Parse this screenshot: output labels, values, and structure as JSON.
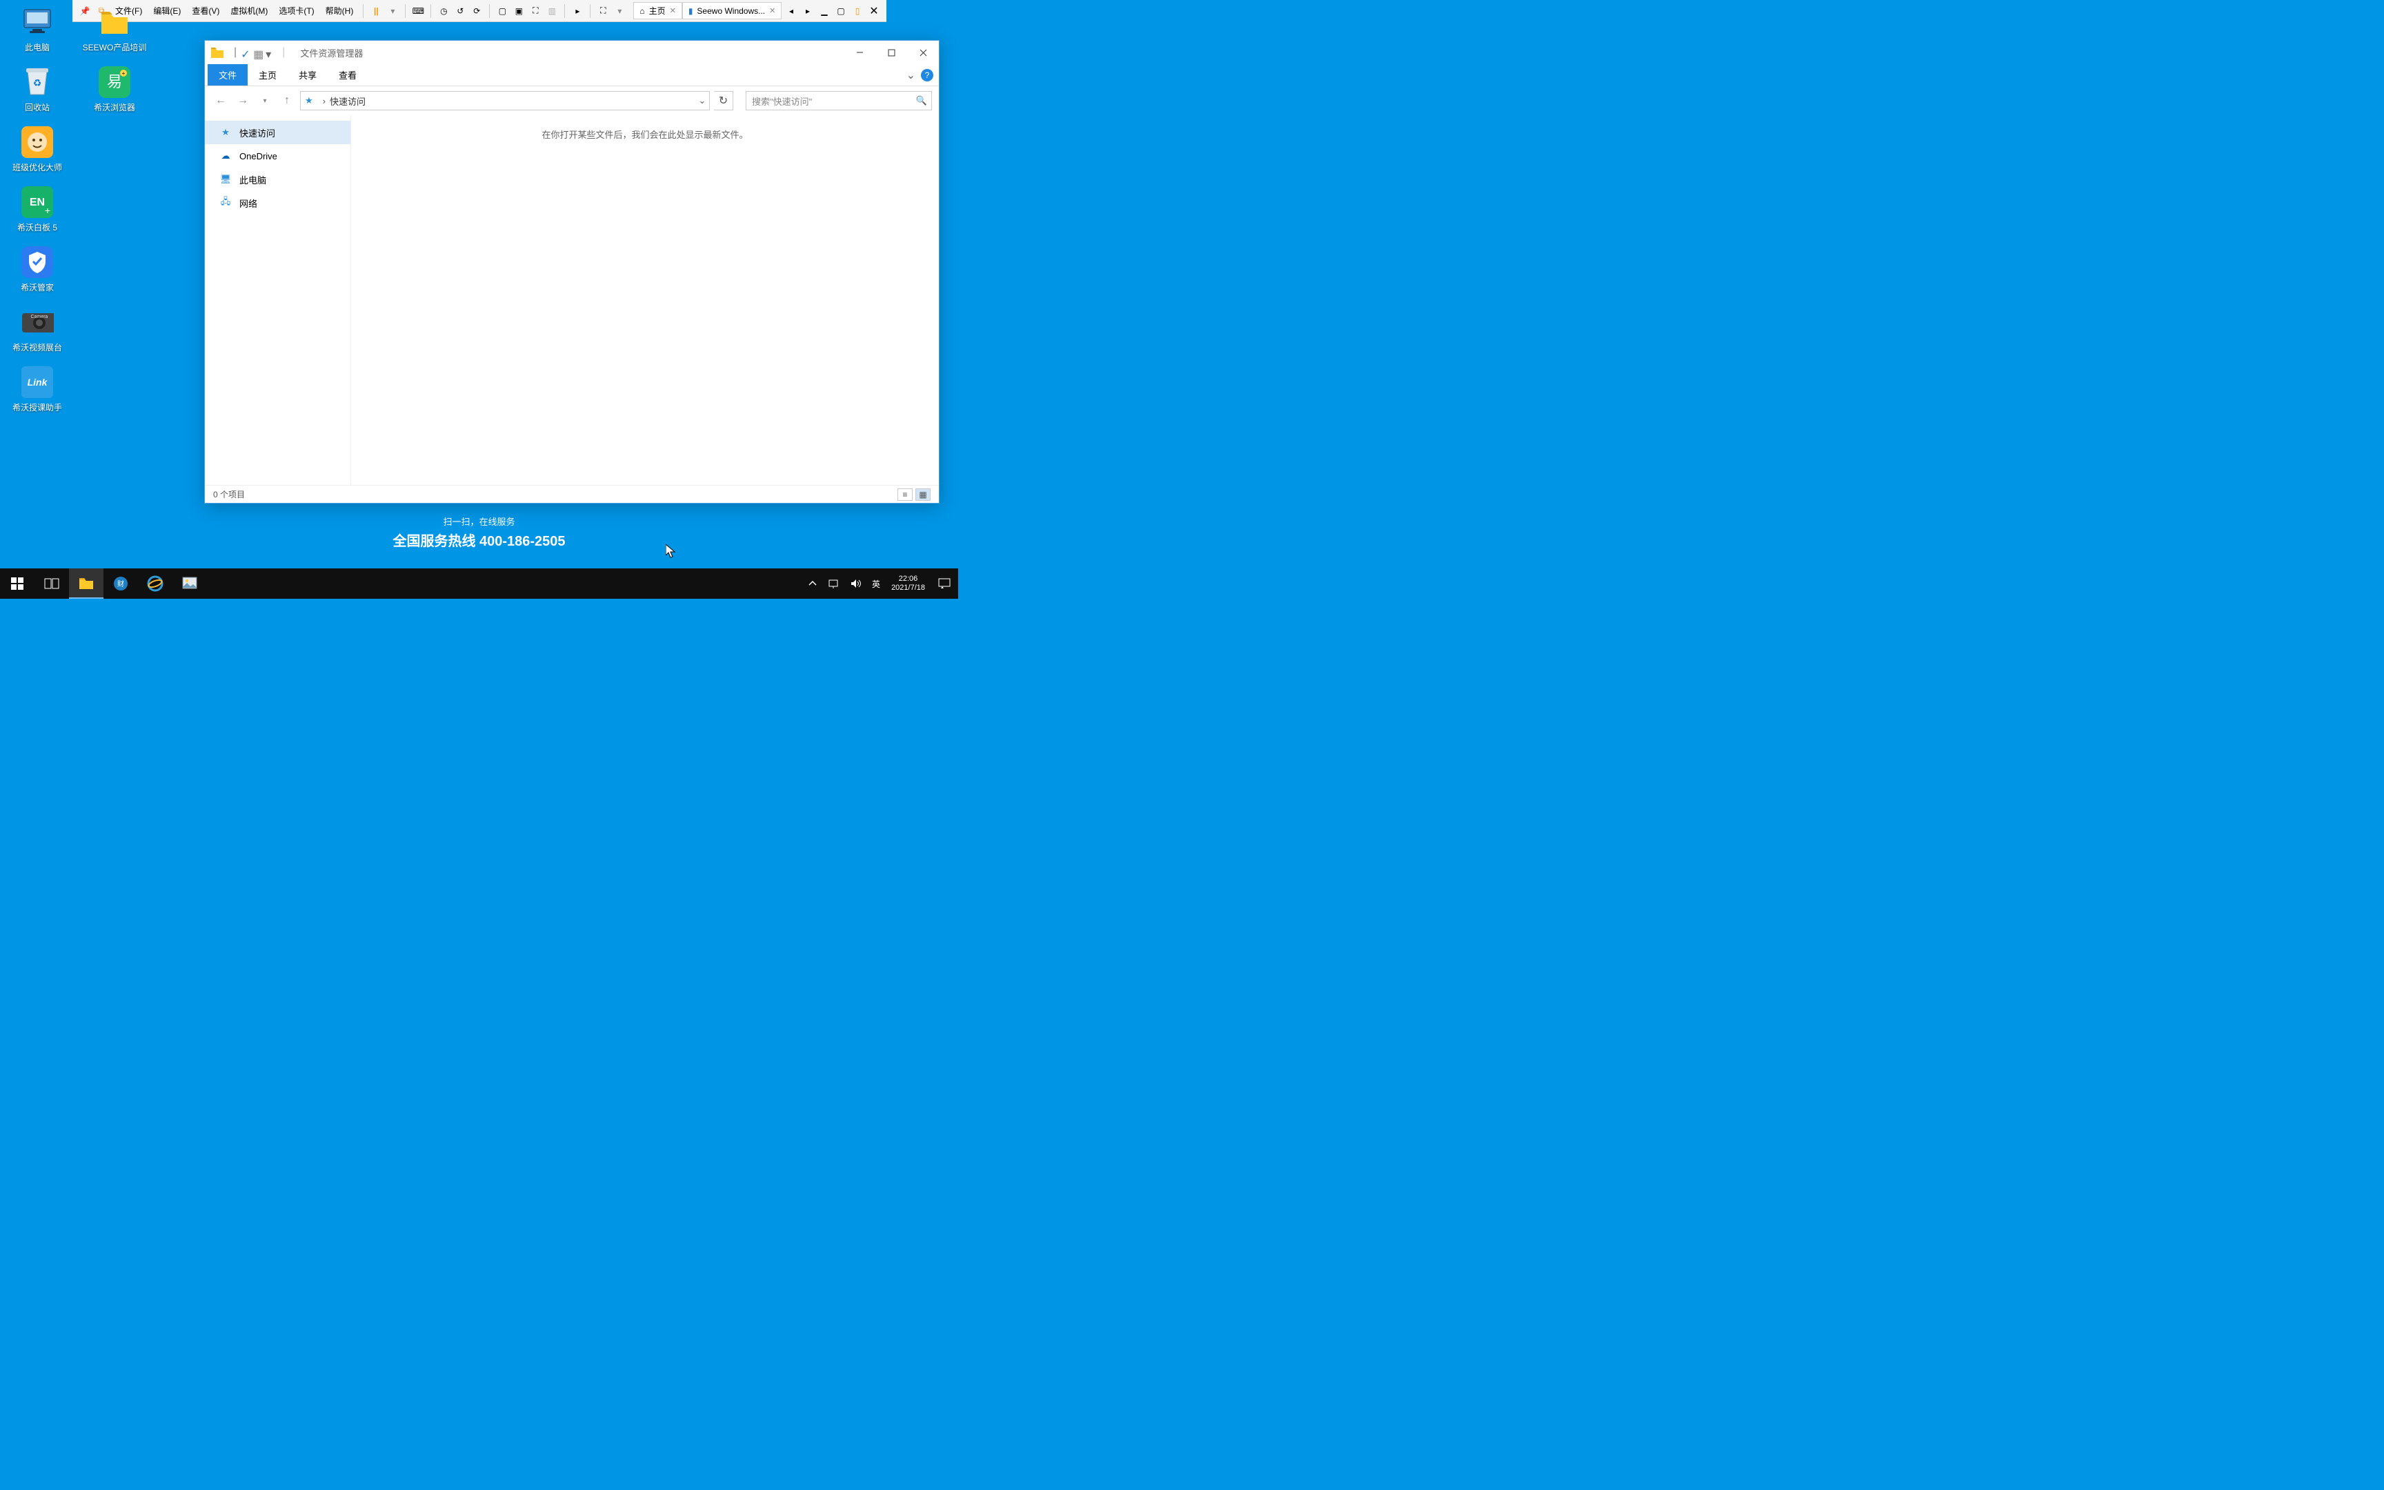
{
  "vmware": {
    "menus": [
      "文件(F)",
      "编辑(E)",
      "查看(V)",
      "虚拟机(M)",
      "选项卡(T)",
      "帮助(H)"
    ],
    "tabs": [
      {
        "label": "主页"
      },
      {
        "label": "Seewo Windows..."
      }
    ]
  },
  "desktop": {
    "col1": [
      {
        "label": "此电脑"
      },
      {
        "label": "回收站"
      },
      {
        "label": "班级优化大师"
      },
      {
        "label": "希沃白板 5"
      },
      {
        "label": "希沃管家"
      },
      {
        "label": "希沃视频展台"
      },
      {
        "label": "希沃授课助手"
      }
    ],
    "col2": [
      {
        "label": "SEEWO产品培训"
      },
      {
        "label": "希沃浏览器"
      }
    ],
    "scan_text": "扫一扫，在线服务",
    "hotline": "全国服务热线 400-186-2505"
  },
  "explorer": {
    "title": "文件资源管理器",
    "tabs": {
      "file": "文件",
      "home": "主页",
      "share": "共享",
      "view": "查看"
    },
    "address": {
      "location": "快速访问"
    },
    "search_placeholder": "搜索\"快速访问\"",
    "sidebar": [
      {
        "label": "快速访问"
      },
      {
        "label": "OneDrive"
      },
      {
        "label": "此电脑"
      },
      {
        "label": "网络"
      }
    ],
    "empty_msg": "在你打开某些文件后，我们会在此处显示最新文件。",
    "status": "0 个项目"
  },
  "taskbar": {
    "ime": "英",
    "time": "22:06",
    "date": "2021/7/18"
  }
}
